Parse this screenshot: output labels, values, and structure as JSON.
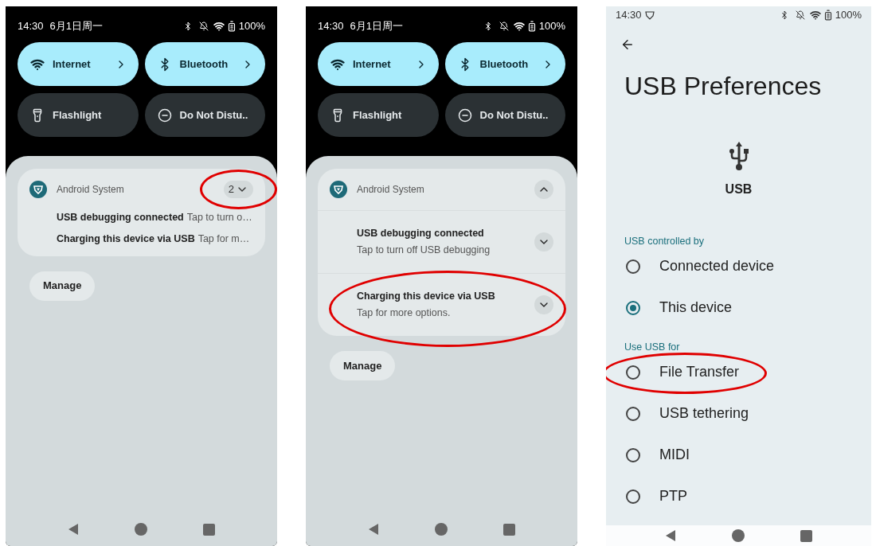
{
  "screens": [
    {
      "kind": "shade",
      "status": {
        "time": "14:30",
        "date": "6月1日周一",
        "battery": "100%"
      },
      "tiles": [
        {
          "label": "Internet",
          "on": true
        },
        {
          "label": "Bluetooth",
          "on": true
        },
        {
          "label": "Flashlight",
          "on": false
        },
        {
          "label": "Do Not Distu..",
          "on": false
        }
      ],
      "notification": {
        "app": "Android System",
        "expanded": false,
        "count": "2",
        "count_highlighted": true,
        "items": [
          {
            "title": "USB debugging connected",
            "text": "Tap to turn o…",
            "highlighted": false
          },
          {
            "title": "Charging this device via USB",
            "text": "Tap for m…",
            "highlighted": false
          }
        ]
      },
      "manage": "Manage"
    },
    {
      "kind": "shade",
      "status": {
        "time": "14:30",
        "date": "6月1日周一",
        "battery": "100%"
      },
      "tiles": [
        {
          "label": "Internet",
          "on": true
        },
        {
          "label": "Bluetooth",
          "on": true
        },
        {
          "label": "Flashlight",
          "on": false
        },
        {
          "label": "Do Not Distu..",
          "on": false
        }
      ],
      "notification": {
        "app": "Android System",
        "expanded": true,
        "count_highlighted": false,
        "items": [
          {
            "title": "USB debugging connected",
            "text": "Tap to turn off USB debugging",
            "highlighted": false
          },
          {
            "title": "Charging this device via USB",
            "text": "Tap for more options.",
            "highlighted": true
          }
        ]
      },
      "manage": "Manage"
    },
    {
      "kind": "settings",
      "status": {
        "time": "14:30",
        "battery": "100%"
      },
      "title": "USB Preferences",
      "device_label": "USB",
      "sections": [
        {
          "header": "USB controlled by",
          "options": [
            {
              "label": "Connected device",
              "selected": false,
              "highlighted": false
            },
            {
              "label": "This device",
              "selected": true,
              "highlighted": false
            }
          ]
        },
        {
          "header": "Use USB for",
          "options": [
            {
              "label": "File Transfer",
              "selected": false,
              "highlighted": true
            },
            {
              "label": "USB tethering",
              "selected": false,
              "highlighted": false
            },
            {
              "label": "MIDI",
              "selected": false,
              "highlighted": false
            },
            {
              "label": "PTP",
              "selected": false,
              "highlighted": false
            }
          ]
        }
      ]
    }
  ]
}
